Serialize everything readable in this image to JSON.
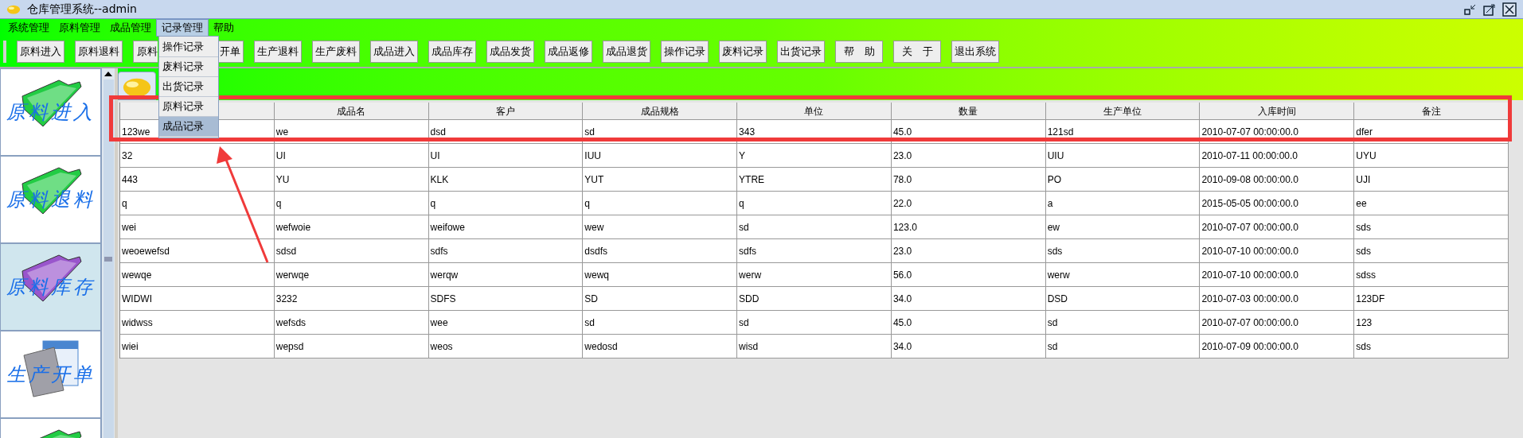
{
  "window": {
    "title": "仓库管理系统--admin"
  },
  "menubar": [
    {
      "label": "系统管理",
      "selected": false
    },
    {
      "label": "原料管理",
      "selected": false
    },
    {
      "label": "成品管理",
      "selected": false
    },
    {
      "label": "记录管理",
      "selected": true
    },
    {
      "label": "帮助",
      "selected": false
    }
  ],
  "open_menu": {
    "items": [
      {
        "label": "操作记录",
        "selected": false
      },
      {
        "label": "废料记录",
        "selected": false
      },
      {
        "label": "出货记录",
        "selected": false
      },
      {
        "label": "原料记录",
        "selected": false
      },
      {
        "label": "成品记录",
        "selected": true
      }
    ]
  },
  "toolbar": [
    {
      "label": "原料进入",
      "kind": "button"
    },
    {
      "label": "原料退料",
      "kind": "button"
    },
    {
      "label": "原料",
      "kind": "cut-right"
    },
    {
      "label": "开单",
      "kind": "cut-left"
    },
    {
      "label": "生产退料",
      "kind": "button"
    },
    {
      "label": "生产废料",
      "kind": "button"
    },
    {
      "label": "成品进入",
      "kind": "button"
    },
    {
      "label": "成品库存",
      "kind": "button"
    },
    {
      "label": "成品发货",
      "kind": "button"
    },
    {
      "label": "成品返修",
      "kind": "button"
    },
    {
      "label": "成品退货",
      "kind": "button"
    },
    {
      "label": "操作记录",
      "kind": "button"
    },
    {
      "label": "废料记录",
      "kind": "button"
    },
    {
      "label": "出货记录",
      "kind": "button"
    },
    {
      "label": "帮　助",
      "kind": "button"
    },
    {
      "label": "关　于",
      "kind": "button"
    },
    {
      "label": "退出系统",
      "kind": "button"
    }
  ],
  "sidebar": {
    "items": [
      {
        "label": "原料进入",
        "kind": "folder",
        "color": "#22cc44",
        "selected": false
      },
      {
        "label": "原料退料",
        "kind": "folder",
        "color": "#22cc44",
        "selected": false
      },
      {
        "label": "原料库存",
        "kind": "folder",
        "color": "#9955cc",
        "selected": true
      },
      {
        "label": "生产开单",
        "kind": "document",
        "color": "#a0a0a8",
        "selected": false
      },
      {
        "kind": "folder",
        "color": "#22cc44",
        "selected": false
      }
    ]
  },
  "table": {
    "columns": [
      "",
      "成品名",
      "客户",
      "成品规格",
      "单位",
      "数量",
      "生产单位",
      "入库时间",
      "备注"
    ],
    "rows": [
      [
        "123we",
        "we",
        "dsd",
        "sd",
        "343",
        "45.0",
        "121sd",
        "2010-07-07 00:00:00.0",
        "dfer"
      ],
      [
        "32",
        "UI",
        "UI",
        "IUU",
        "Y",
        "23.0",
        "UIU",
        "2010-07-11 00:00:00.0",
        "UYU"
      ],
      [
        "443",
        "YU",
        "KLK",
        "YUT",
        "YTRE",
        "78.0",
        "PO",
        "2010-09-08 00:00:00.0",
        "UJI"
      ],
      [
        "q",
        "q",
        "q",
        "q",
        "q",
        "22.0",
        "a",
        "2015-05-05 00:00:00.0",
        "ee"
      ],
      [
        "wei",
        "wefwoie",
        "weifowe",
        "wew",
        "sd",
        "123.0",
        "ew",
        "2010-07-07 00:00:00.0",
        "sds"
      ],
      [
        "weoewefsd",
        "sdsd",
        "sdfs",
        "dsdfs",
        "sdfs",
        "23.0",
        "sds",
        "2010-07-10 00:00:00.0",
        "sds"
      ],
      [
        "wewqe",
        "werwqe",
        "werqw",
        "wewq",
        "werw",
        "56.0",
        "werw",
        "2010-07-10 00:00:00.0",
        "sdss"
      ],
      [
        "WIDWI",
        "3232",
        "SDFS",
        "SD",
        "SDD",
        "34.0",
        "DSD",
        "2010-07-03 00:00:00.0",
        "123DF"
      ],
      [
        "widwss",
        "wefsds",
        "wee",
        "sd",
        "sd",
        "45.0",
        "sd",
        "2010-07-07 00:00:00.0",
        "123"
      ],
      [
        "wiei",
        "wepsd",
        "weos",
        "wedosd",
        "wisd",
        "34.0",
        "sd",
        "2010-07-09 00:00:00.0",
        "sds"
      ]
    ]
  }
}
